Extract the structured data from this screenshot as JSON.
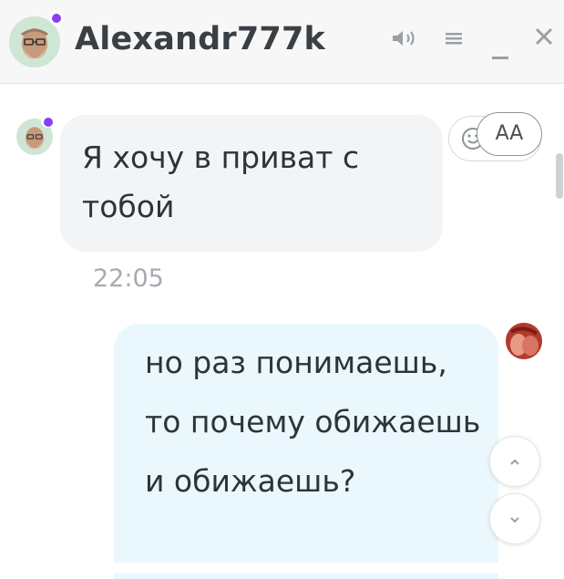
{
  "header": {
    "username": "Alexandr777k",
    "icons": {
      "sound": "speaker-icon",
      "menu": "menu-icon",
      "minimize": "minimize-icon",
      "close": "close-icon"
    },
    "online_color": "#8a3ff0"
  },
  "messages": [
    {
      "direction": "incoming",
      "text": "Я хочу в приват с тобой",
      "time": "22:05"
    },
    {
      "direction": "outgoing",
      "text": "но раз понимаешь, то почему обижаешь и обижаешь?"
    }
  ],
  "controls": {
    "font_size_label": "AA",
    "emoji_icon": "smiley-icon",
    "scroll_up_icon": "chevron-up-icon",
    "scroll_down_icon": "chevron-down-icon"
  },
  "colors": {
    "incoming_bubble": "#f3f4f5",
    "outgoing_bubble": "#eaf7fd"
  }
}
